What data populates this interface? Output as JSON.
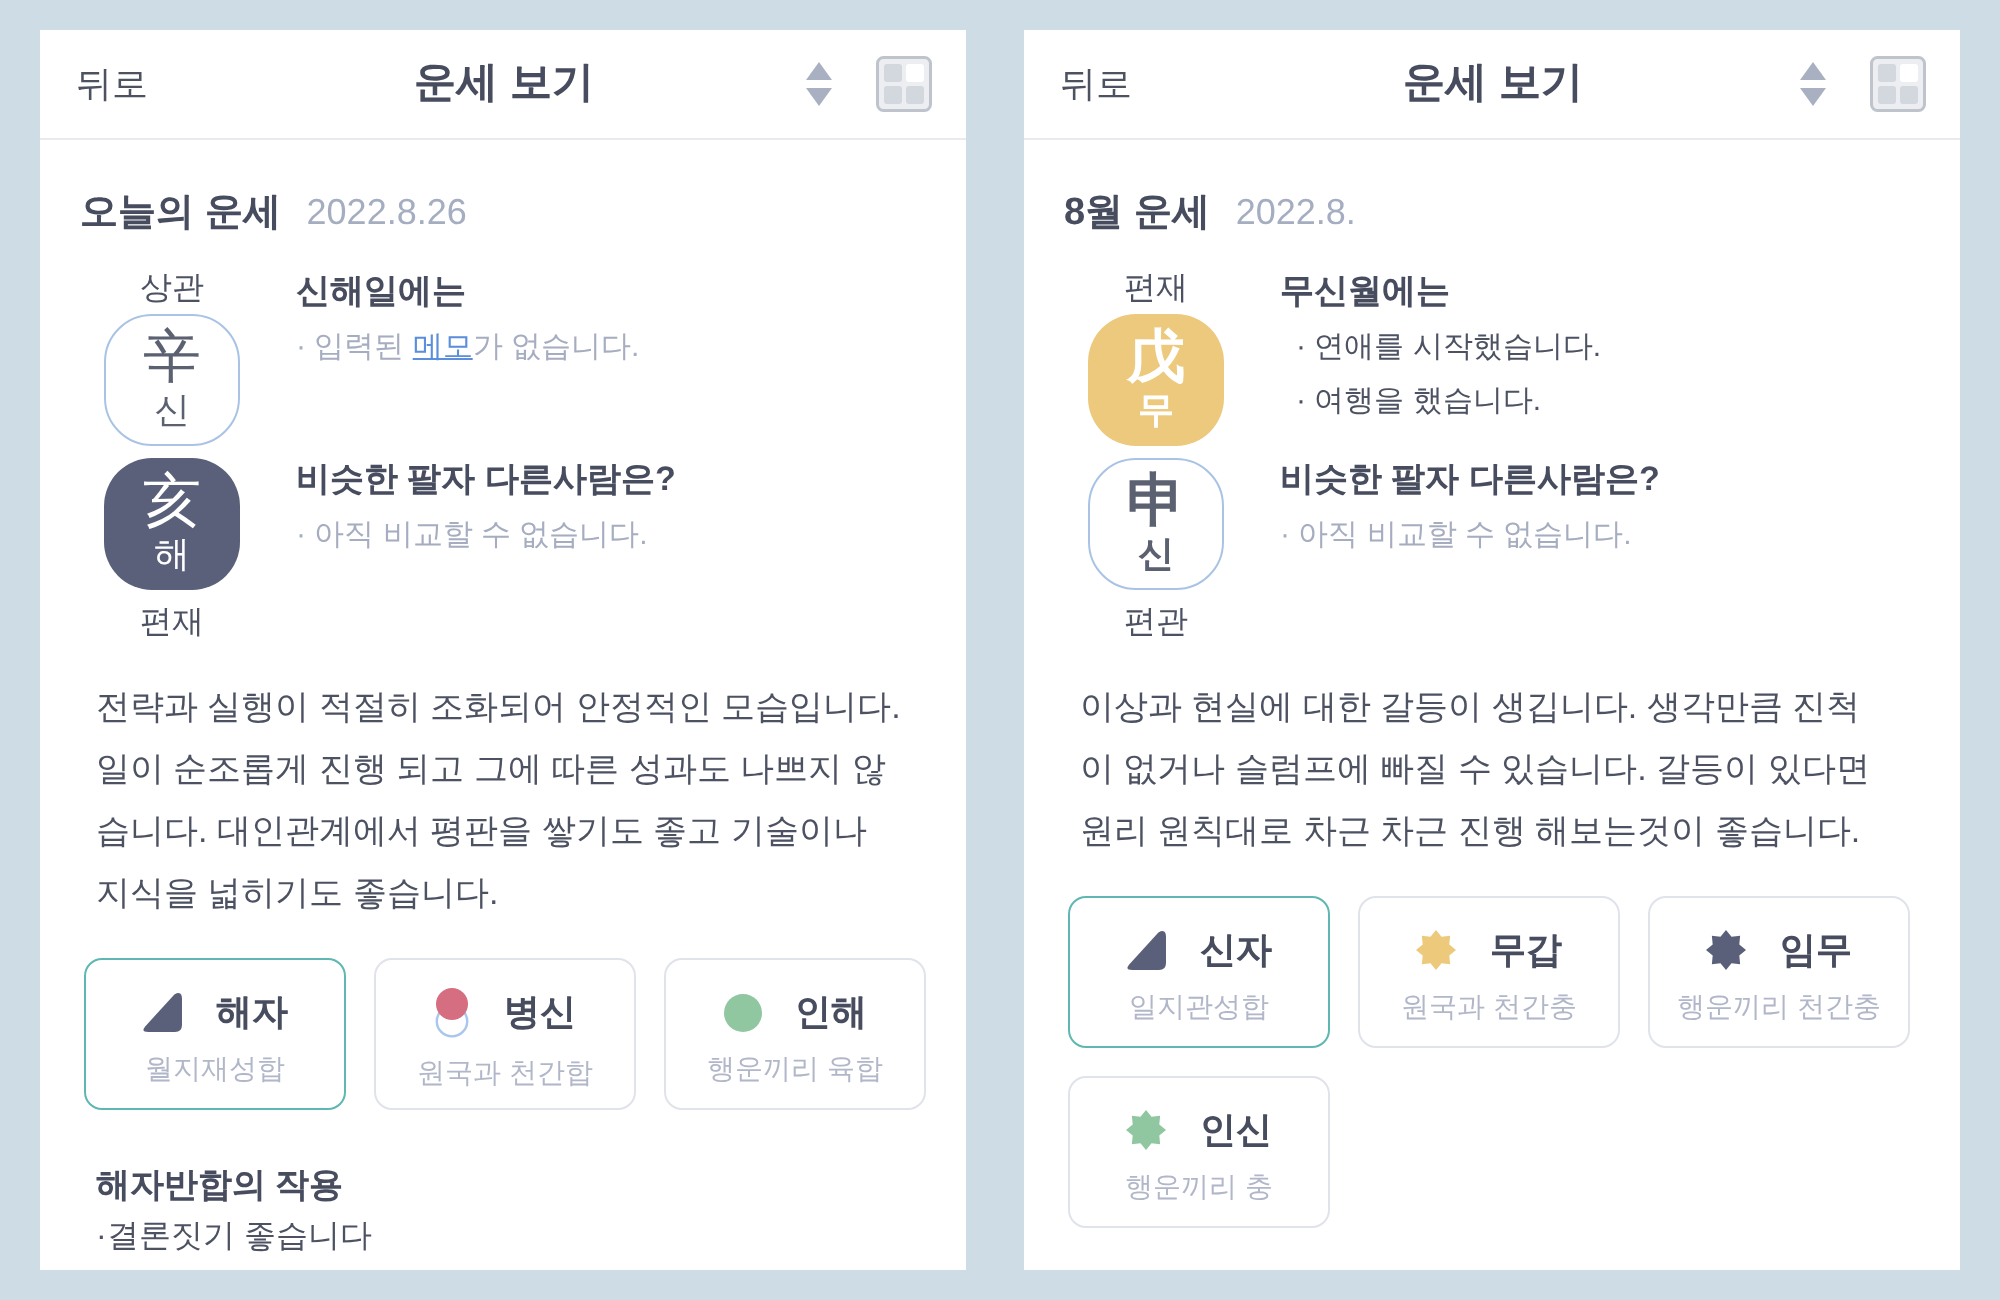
{
  "panels": [
    {
      "header": {
        "back": "뒤로",
        "title": "운세 보기"
      },
      "title": "오늘의 운세",
      "date": "2022.8.26",
      "pillar": {
        "top_label": "상관",
        "badges": [
          {
            "kind": "outline",
            "hanja": "辛",
            "hangul": "신",
            "strong": false
          },
          {
            "kind": "filled",
            "color": "#5a6079",
            "hanja": "亥",
            "hangul": "해",
            "strong": false
          }
        ],
        "bottom_label": "편재"
      },
      "notes": [
        {
          "title": "신해일에는",
          "lines": [
            {
              "muted": true,
              "parts": [
                {
                  "text": "· 입력된 ",
                  "link": false
                },
                {
                  "text": "메모",
                  "link": true
                },
                {
                  "text": "가 없습니다.",
                  "link": false
                }
              ]
            }
          ]
        },
        {
          "title": "비슷한 팔자 다른사람은?",
          "lines": [
            {
              "muted": true,
              "parts": [
                {
                  "text": "· 아직 비교할 수 없습니다.",
                  "link": false
                }
              ]
            }
          ]
        }
      ],
      "text": "전략과 실행이 적절히 조화되어 안정적인 모습입니다. 일이 순조롭게 진행 되고 그에 따른 성과도 나쁘지 않습니다. 대인관계에서 평판을 쌓기도 좋고 기술이나 지식을 넓히기도 좋습니다.",
      "cards": [
        {
          "name": "해자",
          "caption": "월지재성합",
          "selected": true,
          "kind": "triangle",
          "color": "#5a6079"
        },
        {
          "name": "병신",
          "caption": "원국과 천간합",
          "selected": false,
          "kind": "overlap",
          "color": "#d56e80"
        },
        {
          "name": "인해",
          "caption": "행운끼리 육합",
          "selected": false,
          "kind": "circle",
          "color": "#90c7a0"
        }
      ],
      "effect": {
        "title": "해자반합의 작용",
        "text": "·결론짓기 좋습니다"
      }
    },
    {
      "header": {
        "back": "뒤로",
        "title": "운세 보기"
      },
      "title": "8월 운세",
      "date": "2022.8.",
      "pillar": {
        "top_label": "편재",
        "badges": [
          {
            "kind": "filled",
            "color": "#ecc97c",
            "hanja": "戊",
            "hangul": "무",
            "strong": true
          },
          {
            "kind": "outline",
            "hanja": "申",
            "hangul": "신",
            "strong": true
          }
        ],
        "bottom_label": "편관"
      },
      "notes": [
        {
          "title": "무신월에는",
          "lines": [
            {
              "muted": false,
              "parts": [
                {
                  "text": "· 연애를 시작했습니다.",
                  "link": false
                }
              ]
            },
            {
              "muted": false,
              "parts": [
                {
                  "text": "· 여행을 했습니다.",
                  "link": false
                }
              ]
            }
          ]
        },
        {
          "title": "비슷한 팔자 다른사람은?",
          "lines": [
            {
              "muted": true,
              "parts": [
                {
                  "text": "· 아직 비교할 수 없습니다.",
                  "link": false
                }
              ]
            }
          ]
        }
      ],
      "text": "이상과 현실에 대한 갈등이 생깁니다. 생각만큼 진척이 없거나 슬럼프에 빠질 수 있습니다. 갈등이 있다면 원리 원칙대로 차근 차근 진행 해보는것이 좋습니다.",
      "cards": [
        {
          "name": "신자",
          "caption": "일지관성합",
          "selected": true,
          "kind": "triangle",
          "color": "#5a6079"
        },
        {
          "name": "무갑",
          "caption": "원국과 천간충",
          "selected": false,
          "kind": "burst",
          "color": "#edc97b"
        },
        {
          "name": "임무",
          "caption": "행운끼리 천간충",
          "selected": false,
          "kind": "burst",
          "color": "#5a6079"
        },
        {
          "name": "인신",
          "caption": "행운끼리 충",
          "selected": false,
          "kind": "burst",
          "color": "#90c7a0"
        }
      ]
    }
  ]
}
